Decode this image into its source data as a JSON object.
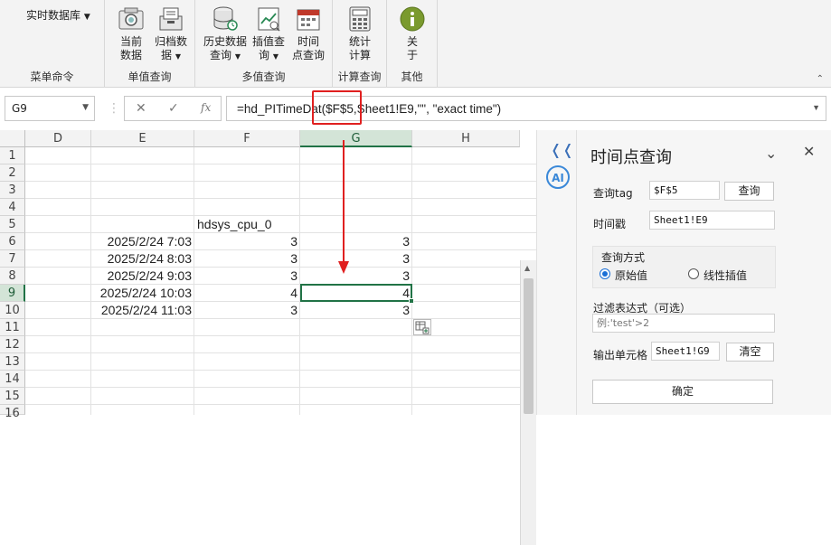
{
  "ribbon": {
    "menu_group": {
      "dropdown_label": "实时数据库",
      "label": "菜单命令"
    },
    "single_group": {
      "label": "单值查询",
      "buttons": [
        {
          "line1": "当前",
          "line2": "数据"
        },
        {
          "line1": "归档数",
          "line2": "据"
        }
      ]
    },
    "multi_group": {
      "label": "多值查询",
      "buttons": [
        {
          "line1": "历史数据",
          "line2": "查询"
        },
        {
          "line1": "插值查",
          "line2": "询"
        },
        {
          "line1": "时间",
          "line2": "点查询"
        }
      ]
    },
    "calc_group": {
      "label": "计算查询",
      "buttons": [
        {
          "line1": "统计",
          "line2": "计算"
        }
      ]
    },
    "other_group": {
      "label": "其他",
      "buttons": [
        {
          "line1": "关",
          "line2": "于"
        }
      ]
    }
  },
  "formula_bar": {
    "name_box": "G9",
    "fx_label": "fx",
    "formula": "=hd_PITimeDat($F$5,Sheet1!E9,\"\", \"exact time\")"
  },
  "sheet": {
    "columns": [
      "D",
      "E",
      "F",
      "G",
      "H"
    ],
    "rows": [
      "1",
      "2",
      "3",
      "4",
      "5",
      "6",
      "7",
      "8",
      "9",
      "10",
      "11",
      "12",
      "13",
      "14",
      "15",
      "16"
    ],
    "f5_header": "hdsys_cpu_0",
    "data_rows": [
      {
        "e": "2025/2/24 7:03",
        "f": "3",
        "g": "3"
      },
      {
        "e": "2025/2/24 8:03",
        "f": "3",
        "g": "3"
      },
      {
        "e": "2025/2/24 9:03",
        "f": "3",
        "g": "3"
      },
      {
        "e": "2025/2/24 10:03",
        "f": "4",
        "g": "4"
      },
      {
        "e": "2025/2/24 11:03",
        "f": "3",
        "g": "3"
      }
    ]
  },
  "panel": {
    "title": "时间点查询",
    "tag_label": "查询tag",
    "tag_value": "$F$5",
    "query_button": "查询",
    "timestamp_label": "时间戳",
    "timestamp_value": "Sheet1!E9",
    "method_label": "查询方式",
    "method_raw": "原始值",
    "method_interp": "线性插值",
    "filter_label": "过滤表达式（可选）",
    "filter_placeholder": "例:'test'>2",
    "output_label": "输出单元格",
    "output_value": "Sheet1!G9",
    "clear_button": "清空",
    "ok_button": "确定"
  },
  "colors": {
    "excel_green": "#217346",
    "annotation_red": "#e02020",
    "radio_blue": "#1a6fd6"
  }
}
